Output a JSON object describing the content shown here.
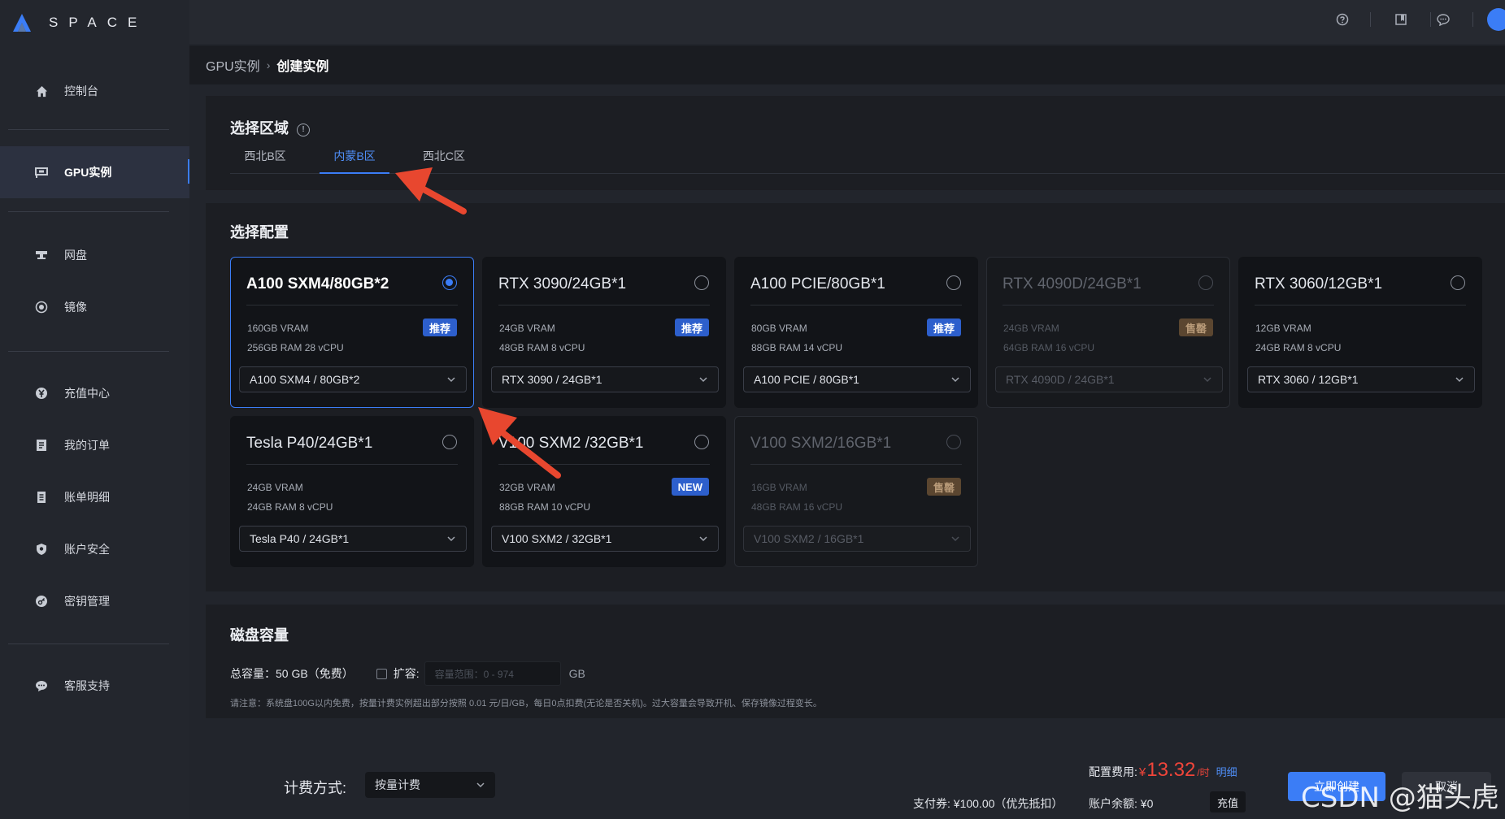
{
  "brand": {
    "logo_text": "SPACE"
  },
  "sidebar": {
    "items": [
      {
        "label": "控制台",
        "icon": "home-icon"
      },
      {
        "label": "GPU实例",
        "icon": "gpu-icon",
        "active": true
      },
      {
        "label": "网盘",
        "icon": "cloud-drive-icon"
      },
      {
        "label": "镜像",
        "icon": "image-icon"
      },
      {
        "label": "充值中心",
        "icon": "yen-icon"
      },
      {
        "label": "我的订单",
        "icon": "orders-icon"
      },
      {
        "label": "账单明细",
        "icon": "bill-icon"
      },
      {
        "label": "账户安全",
        "icon": "shield-icon"
      },
      {
        "label": "密钥管理",
        "icon": "key-icon"
      },
      {
        "label": "客服支持",
        "icon": "chat-icon"
      }
    ]
  },
  "topbar": {
    "icons": [
      "help-icon",
      "book-icon",
      "message-icon"
    ]
  },
  "breadcrumb": {
    "parent": "GPU实例",
    "separator": "›",
    "current": "创建实例"
  },
  "region": {
    "title": "选择区域",
    "tabs": [
      {
        "label": "西北B区"
      },
      {
        "label": "内蒙B区",
        "active": true
      },
      {
        "label": "西北C区"
      }
    ]
  },
  "config": {
    "title": "选择配置",
    "cards": [
      {
        "name": "A100 SXM4/80GB*2",
        "spec1": "160GB VRAM",
        "spec2": "256GB RAM 28 vCPU",
        "badge": "推荐",
        "select": "A100 SXM4 / 80GB*2",
        "selected": true
      },
      {
        "name": "RTX 3090/24GB*1",
        "spec1": "24GB VRAM",
        "spec2": "48GB RAM 8 vCPU",
        "badge": "推荐",
        "select": "RTX 3090 / 24GB*1"
      },
      {
        "name": "A100 PCIE/80GB*1",
        "spec1": "80GB VRAM",
        "spec2": "88GB RAM 14 vCPU",
        "badge": "推荐",
        "select": "A100 PCIE / 80GB*1"
      },
      {
        "name": "RTX 4090D/24GB*1",
        "spec1": "24GB VRAM",
        "spec2": "64GB RAM 16 vCPU",
        "badge": "售罄",
        "select": "RTX 4090D / 24GB*1",
        "disabled": true
      },
      {
        "name": "RTX 3060/12GB*1",
        "spec1": "12GB VRAM",
        "spec2": "24GB RAM 8 vCPU",
        "badge": "",
        "select": "RTX 3060 / 12GB*1"
      },
      {
        "name": "Tesla P40/24GB*1",
        "spec1": "24GB VRAM",
        "spec2": "24GB RAM 8 vCPU",
        "badge": "",
        "select": "Tesla P40 / 24GB*1"
      },
      {
        "name": "V100 SXM2 /32GB*1",
        "spec1": "32GB VRAM",
        "spec2": "88GB RAM 10 vCPU",
        "badge": "NEW",
        "select": "V100 SXM2 / 32GB*1"
      },
      {
        "name": "V100 SXM2/16GB*1",
        "spec1": "16GB VRAM",
        "spec2": "48GB RAM 16 vCPU",
        "badge": "售罄",
        "select": "V100 SXM2 / 16GB*1",
        "disabled": true
      }
    ]
  },
  "disk": {
    "title": "磁盘容量",
    "total": "总容量：50 GB（免费）",
    "expand_label": "扩容:",
    "placeholder": "容量范围：0 - 974",
    "unit": "GB",
    "note": "请注意：系统盘100G以内免费，按量计费实例超出部分按照 0.01 元/日/GB，每日0点扣费(无论是否关机)。过大容量会导致开机、保存镜像过程变长。"
  },
  "billing": {
    "label": "计费方式:",
    "mode": "按量计费",
    "fee_label": "配置费用:",
    "fee_currency": "¥",
    "fee_value": "13.32",
    "fee_unit": "/时",
    "fee_detail": "明细",
    "voucher": "支付券: ¥100.00（优先抵扣）",
    "balance": "账户余额: ¥0",
    "recharge": "充值",
    "create": "立即创建",
    "cancel": "取消"
  },
  "watermark": "CSDN @猫头虎",
  "colors": {
    "accent": "#3b7df6",
    "price": "#f0453a",
    "annotation_arrow": "#e8472f"
  }
}
